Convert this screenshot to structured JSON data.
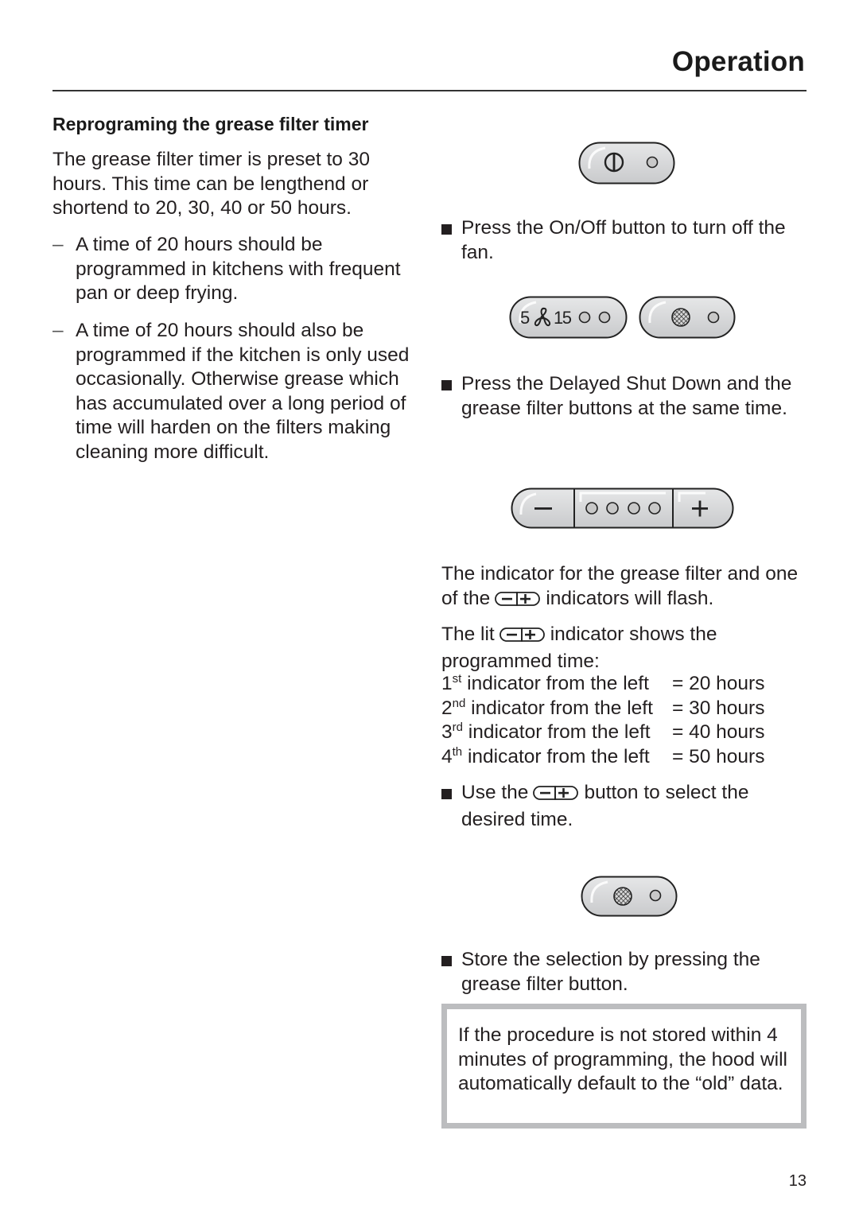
{
  "header": {
    "title": "Operation"
  },
  "section": {
    "heading": "Reprograming the grease filter timer",
    "intro": "The grease filter timer is preset to 30 hours. This time can be lengthend or shortend to 20, 30, 40 or 50 hours.",
    "dash_items": [
      {
        "dash": "–",
        "text": "A time of 20 hours should be programmed in kitchens with frequent pan or deep frying."
      },
      {
        "dash": "–",
        "text": "A time of 20 hours should also be programmed if the kitchen is only used occasionally. Otherwise grease which has accumulated over a long period of time will harden on the filters making cleaning more difficult."
      }
    ]
  },
  "panels": {
    "fan_display": {
      "left_value": "5",
      "right_value": "15",
      "fan_icon": "fan-icon"
    },
    "icons": {
      "power": "power-icon",
      "grease_filter": "grease-filter-icon",
      "indicator": "indicator-light-icon",
      "minus": "minus-icon",
      "plus": "plus-icon"
    },
    "minus_label": "–",
    "plus_label": "+"
  },
  "steps": {
    "step1": "Press the On/Off button to turn off the fan.",
    "step2": "Press the Delayed Shut Down and the grease filter buttons at the same time.",
    "flash_pre": "The indicator for the grease filter and one of the",
    "flash_post": "indicators will flash.",
    "lit_pre": "The lit",
    "lit_post": "indicator shows the programmed time:",
    "indicator_table": [
      {
        "ordinal": "1",
        "suffix": "st",
        "label": "indicator from the left",
        "value": "= 20 hours"
      },
      {
        "ordinal": "2",
        "suffix": "nd",
        "label": "indicator from the left",
        "value": "= 30 hours"
      },
      {
        "ordinal": "3",
        "suffix": "rd",
        "label": "indicator from the left",
        "value": "= 40 hours"
      },
      {
        "ordinal": "4",
        "suffix": "th",
        "label": "indicator from the left",
        "value": "= 50 hours"
      }
    ],
    "step3_pre": "Use the",
    "step3_post": "button to select the desired time.",
    "step4": "Store the selection by pressing the grease filter button."
  },
  "note": {
    "text": "If the procedure is not stored within 4 minutes of programming, the hood will automatically default to the “old” data."
  },
  "footer": {
    "page_number": "13"
  }
}
